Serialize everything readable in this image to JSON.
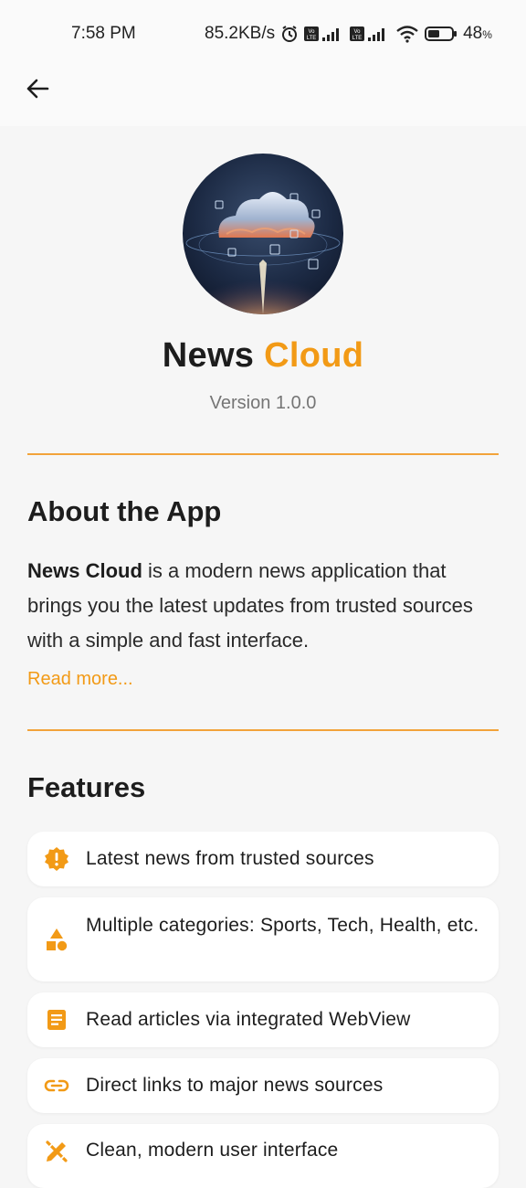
{
  "status_bar": {
    "time": "7:58 PM",
    "network_speed": "85.2KB/s",
    "battery": "48",
    "battery_unit": "%"
  },
  "app_bar": {
    "back_icon": "arrow-left-icon"
  },
  "header": {
    "logo_icon": "cloud-logo-image",
    "title_main": "News",
    "title_accent": "Cloud",
    "version": "Version 1.0.0"
  },
  "about": {
    "heading": "About the App",
    "app_name": "News Cloud",
    "description": " is a modern news application that brings you the latest updates from trusted sources with a simple and fast interface.",
    "read_more": "Read more..."
  },
  "features": {
    "heading": "Features",
    "items": [
      {
        "icon": "alert-badge-icon",
        "label": "Latest news from trusted sources"
      },
      {
        "icon": "category-shapes-icon",
        "label": "Multiple categories: Sports, Tech, Health, etc."
      },
      {
        "icon": "article-icon",
        "label": "Read articles via integrated WebView"
      },
      {
        "icon": "link-icon",
        "label": "Direct links to major news sources"
      },
      {
        "icon": "design-tools-icon",
        "label": "Clean, modern user interface"
      }
    ]
  },
  "colors": {
    "accent": "#f29a16",
    "background": "#f6f6f6",
    "card": "#ffffff",
    "text": "#1d1d1d"
  }
}
